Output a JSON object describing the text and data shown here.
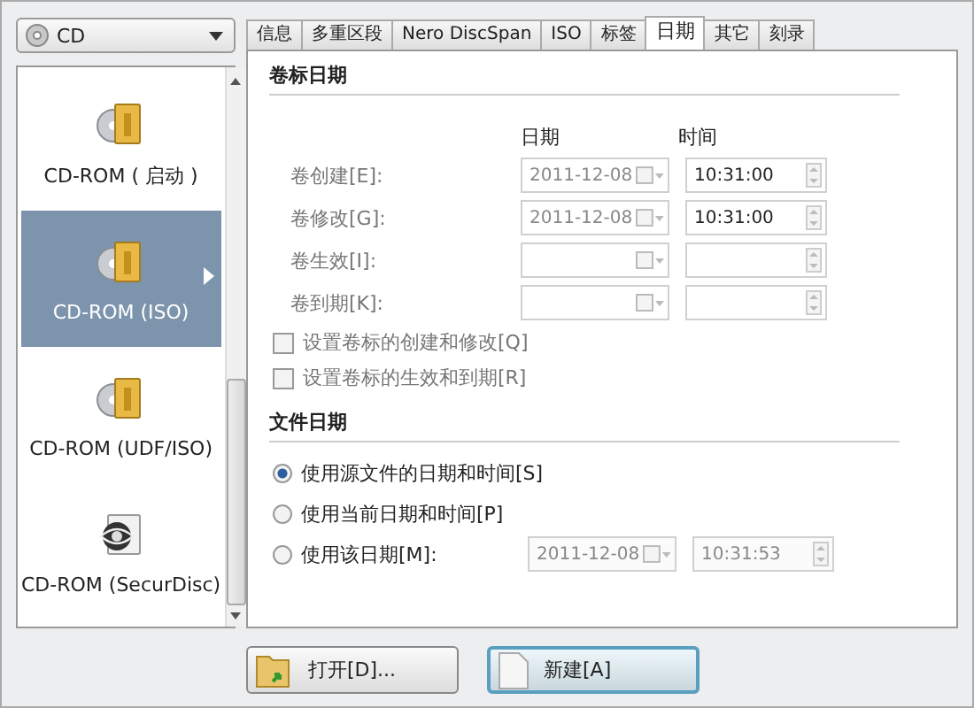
{
  "drive_select": {
    "value": "CD"
  },
  "formats": [
    {
      "label": "CD-ROM ( 启动 )",
      "kind": "standard",
      "selected": false
    },
    {
      "label": "CD-ROM (ISO)",
      "kind": "standard",
      "selected": true
    },
    {
      "label": "CD-ROM (UDF/ISO)",
      "kind": "standard",
      "selected": false
    },
    {
      "label": "CD-ROM (SecurDisc)",
      "kind": "secure",
      "selected": false
    }
  ],
  "tabs": [
    {
      "label": "信息",
      "selected": false
    },
    {
      "label": "多重区段",
      "selected": false
    },
    {
      "label": "Nero DiscSpan",
      "selected": false
    },
    {
      "label": "ISO",
      "selected": false
    },
    {
      "label": "标签",
      "selected": false
    },
    {
      "label": "日期",
      "selected": true
    },
    {
      "label": "其它",
      "selected": false
    },
    {
      "label": "刻录",
      "selected": false
    }
  ],
  "volume_dates": {
    "title": "卷标日期",
    "disabled": true,
    "column_headers": [
      "日期",
      "时间"
    ],
    "rows": [
      {
        "label": "卷创建[E]:",
        "date": "2011-12-08",
        "time": "10:31:00"
      },
      {
        "label": "卷修改[G]:",
        "date": "2011-12-08",
        "time": "10:31:00"
      },
      {
        "label": "卷生效[I]:"
      },
      {
        "label": "卷到期[K]:"
      }
    ],
    "checkboxes": [
      {
        "label": "设置卷标的创建和修改[Q]",
        "checked": false
      },
      {
        "label": "设置卷标的生效和到期[R]",
        "checked": false
      }
    ]
  },
  "file_dates": {
    "title": "文件日期",
    "options": [
      {
        "label": "使用源文件的日期和时间[S]",
        "selected": true
      },
      {
        "label": "使用当前日期和时间[P]",
        "selected": false
      },
      {
        "label": "使用该日期[M]:",
        "selected": false,
        "date": "2011-12-08",
        "time": "10:31:53",
        "fields_disabled": true
      }
    ]
  },
  "buttons": [
    {
      "label": "打开[D]...",
      "kind": "open",
      "default": false
    },
    {
      "label": "新建[A]",
      "kind": "new",
      "default": true
    }
  ]
}
